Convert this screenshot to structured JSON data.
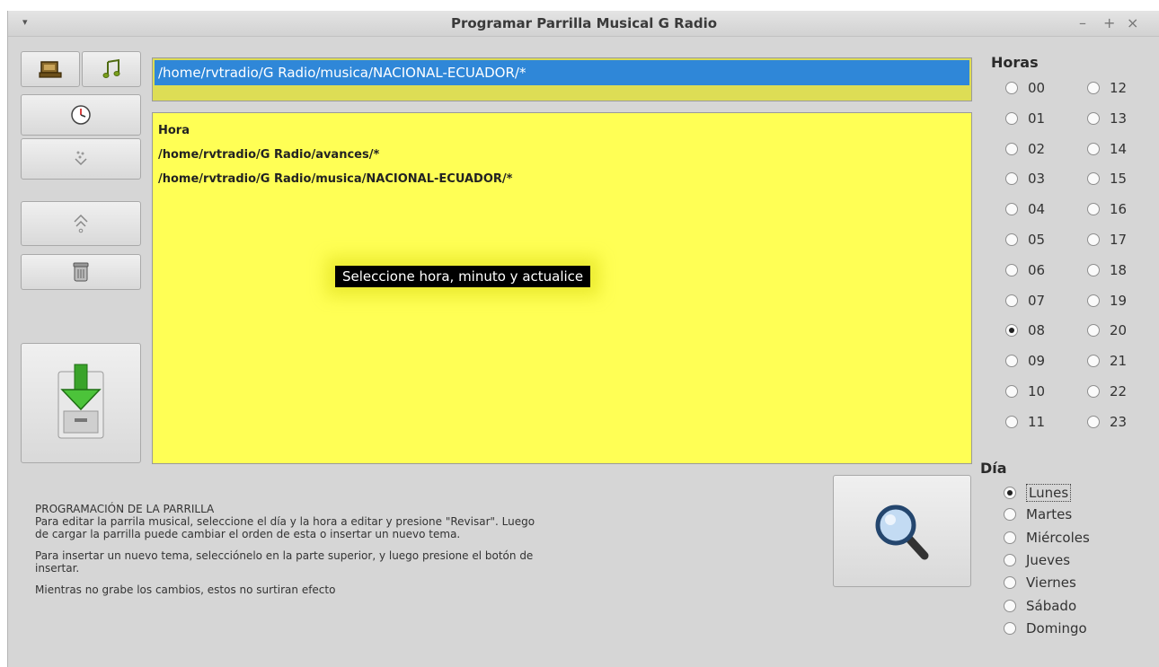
{
  "window": {
    "title": "Programar Parrilla Musical G Radio",
    "menu_glyph": "▾",
    "controls": [
      "–",
      "+",
      "×"
    ]
  },
  "toolbar": {
    "icons": [
      "folder-icon",
      "music-note-icon",
      "clock-icon",
      "insert-icon",
      "move-up-icon",
      "trash-icon",
      "save-download-icon",
      "search-magnifier-icon"
    ]
  },
  "path_selector": {
    "selected": "/home/rvtradio/G Radio/musica/NACIONAL-ECUADOR/*"
  },
  "schedule_list": {
    "items": [
      "Hora",
      "/home/rvtradio/G Radio/avances/*",
      "/home/rvtradio/G Radio/musica/NACIONAL-ECUADOR/*"
    ]
  },
  "tooltip": "Seleccione hora,  minuto y actualice",
  "hours": {
    "title": "Horas",
    "left": [
      "00",
      "01",
      "02",
      "03",
      "04",
      "05",
      "06",
      "07",
      "08",
      "09",
      "10",
      "11"
    ],
    "right": [
      "12",
      "13",
      "14",
      "15",
      "16",
      "17",
      "18",
      "19",
      "20",
      "21",
      "22",
      "23"
    ],
    "selected": "08"
  },
  "days": {
    "title": "Día",
    "items": [
      "Lunes",
      "Martes",
      "Miércoles",
      "Jueves",
      "Viernes",
      "Sábado",
      "Domingo"
    ],
    "selected": "Lunes"
  },
  "help": {
    "heading": "PROGRAMACIÓN DE LA PARRILLA",
    "para1": "Para editar la parrila musical, seleccione el día y la hora a editar y presione \"Revisar\". Luego de cargar la parrilla puede cambiar el orden de esta o insertar un nuevo tema.",
    "para2": "Para insertar un nuevo tema, selecciónelo en la parte superior, y luego presione el botón de insertar.",
    "para3": "Mientras no grabe los cambios, estos no surtiran efecto"
  },
  "colors": {
    "window_bg": "#d6d6d6",
    "list_bg": "#ffff55",
    "path_bg": "#dddd55",
    "selection": "#2f87d8"
  }
}
